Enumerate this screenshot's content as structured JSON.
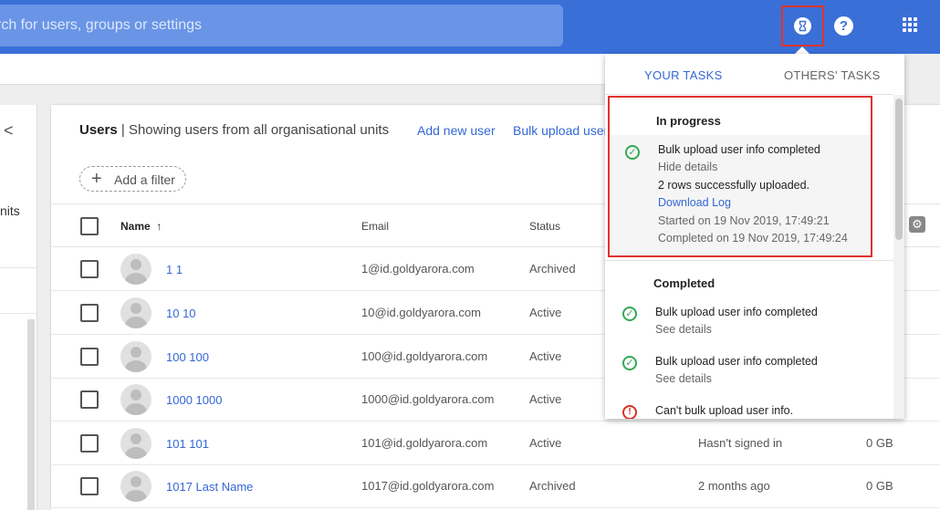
{
  "search": {
    "text": "rch for users, groups or settings"
  },
  "topbar": {
    "help_glyph": "?",
    "task_glyph": "8"
  },
  "left": {
    "back_glyph": "<",
    "units_text": "nits"
  },
  "users": {
    "title_bold": "Users",
    "title_rest": "| Showing users from all organisational units",
    "add_new_user": "Add new user",
    "bulk_upload": "Bulk upload user",
    "filter_label": "Add a filter",
    "columns": {
      "name": "Name",
      "email": "Email",
      "status": "Status"
    },
    "rows": [
      {
        "name": "1 1",
        "email": "1@id.goldyarora.com",
        "status": "Archived",
        "last_sign_in": "",
        "storage": ""
      },
      {
        "name": "10 10",
        "email": "10@id.goldyarora.com",
        "status": "Active",
        "last_sign_in": "",
        "storage": ""
      },
      {
        "name": "100 100",
        "email": "100@id.goldyarora.com",
        "status": "Active",
        "last_sign_in": "",
        "storage": ""
      },
      {
        "name": "1000 1000",
        "email": "1000@id.goldyarora.com",
        "status": "Active",
        "last_sign_in": "",
        "storage": ""
      },
      {
        "name": "101 101",
        "email": "101@id.goldyarora.com",
        "status": "Active",
        "last_sign_in": "Hasn't signed in",
        "storage": "0 GB"
      },
      {
        "name": "1017 Last Name",
        "email": "1017@id.goldyarora.com",
        "status": "Archived",
        "last_sign_in": "2 months ago",
        "storage": "0 GB"
      }
    ]
  },
  "tasks": {
    "tab_yours": "YOUR TASKS",
    "tab_others": "OTHERS' TASKS",
    "in_progress_title": "In progress",
    "in_progress": {
      "title": "Bulk upload user info completed",
      "hide": "Hide details",
      "rows_msg": "2 rows successfully uploaded.",
      "download": "Download Log",
      "started": "Started on 19 Nov 2019, 17:49:21",
      "completed": "Completed on 19 Nov 2019, 17:49:24"
    },
    "completed_title": "Completed",
    "completed": [
      {
        "title": "Bulk upload user info completed",
        "details": "See details"
      },
      {
        "title": "Bulk upload user info completed",
        "details": "See details"
      }
    ],
    "error_title": "Can't bulk upload user info."
  },
  "colors": {
    "accent": "#3b6fd8",
    "link": "#3367d6",
    "highlight": "#e0332c",
    "success": "#34a853",
    "error": "#d93025"
  }
}
